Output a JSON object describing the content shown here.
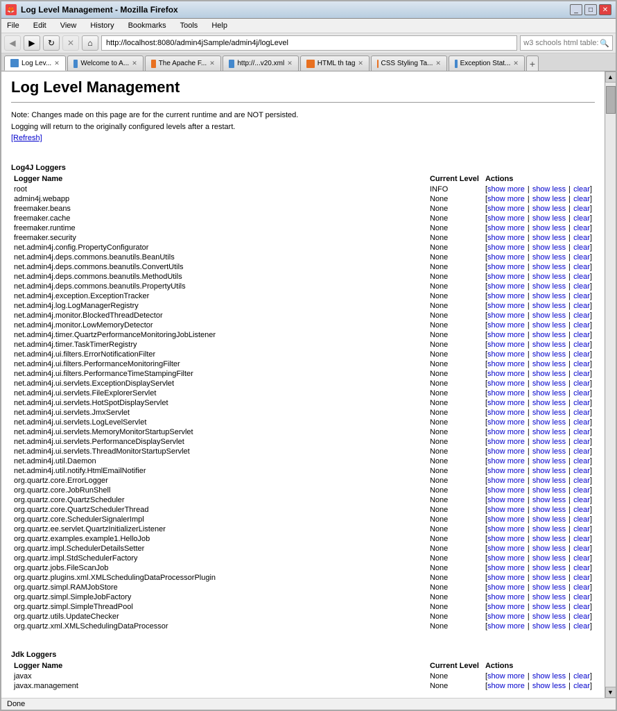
{
  "browser": {
    "title": "Log Level Management - Mozilla Firefox",
    "address": "http://localhost:8080/admin4jSample/admin4j/logLevel",
    "search_placeholder": "w3 schools html table:",
    "tabs": [
      {
        "label": "Log Lev...",
        "active": true,
        "icon": "blue"
      },
      {
        "label": "Welcome to A...",
        "active": false,
        "icon": "blue"
      },
      {
        "label": "The Apache F...",
        "active": false,
        "icon": "orange"
      },
      {
        "label": "http://...v20.xml",
        "active": false,
        "icon": "blue"
      },
      {
        "label": "HTML th tag",
        "active": false,
        "icon": "orange"
      },
      {
        "label": "CSS Styling Ta...",
        "active": false,
        "icon": "orange"
      },
      {
        "label": "Exception Stat...",
        "active": false,
        "icon": "blue"
      }
    ],
    "menus": [
      "File",
      "Edit",
      "View",
      "History",
      "Bookmarks",
      "Tools",
      "Help"
    ]
  },
  "page": {
    "title": "Log Level Management",
    "note_line1": "Note: Changes made on this page are for the current runtime and are NOT persisted.",
    "note_line2": "Logging will return to the originally configured levels after a restart.",
    "refresh_label": "[Refresh]",
    "log4j_section": "Log4J Loggers",
    "jdk_section": "Jdk Loggers",
    "col_logger": "Logger Name",
    "col_current": "Current Level",
    "col_actions": "Actions",
    "action_show_more": "show more",
    "action_show_less": "show less",
    "action_clear": "clear",
    "loggers": [
      {
        "name": "root",
        "level": "INFO"
      },
      {
        "name": "admin4j.webapp",
        "level": "None"
      },
      {
        "name": "freemaker.beans",
        "level": "None"
      },
      {
        "name": "freemaker.cache",
        "level": "None"
      },
      {
        "name": "freemaker.runtime",
        "level": "None"
      },
      {
        "name": "freemaker.security",
        "level": "None"
      },
      {
        "name": "net.admin4j.config.PropertyConfigurator",
        "level": "None"
      },
      {
        "name": "net.admin4j.deps.commons.beanutils.BeanUtils",
        "level": "None"
      },
      {
        "name": "net.admin4j.deps.commons.beanutils.ConvertUtils",
        "level": "None"
      },
      {
        "name": "net.admin4j.deps.commons.beanutils.MethodUtils",
        "level": "None"
      },
      {
        "name": "net.admin4j.deps.commons.beanutils.PropertyUtils",
        "level": "None"
      },
      {
        "name": "net.admin4j.exception.ExceptionTracker",
        "level": "None"
      },
      {
        "name": "net.admin4j.log.LogManagerRegistry",
        "level": "None"
      },
      {
        "name": "net.admin4j.monitor.BlockedThreadDetector",
        "level": "None"
      },
      {
        "name": "net.admin4j.monitor.LowMemoryDetector",
        "level": "None"
      },
      {
        "name": "net.admin4j.timer.QuartzPerformanceMonitoringJobListener",
        "level": "None"
      },
      {
        "name": "net.admin4j.timer.TaskTimerRegistry",
        "level": "None"
      },
      {
        "name": "net.admin4j.ui.filters.ErrorNotificationFilter",
        "level": "None"
      },
      {
        "name": "net.admin4j.ui.filters.PerformanceMonitoringFilter",
        "level": "None"
      },
      {
        "name": "net.admin4j.ui.filters.PerformanceTimeStampingFilter",
        "level": "None"
      },
      {
        "name": "net.admin4j.ui.servlets.ExceptionDisplayServlet",
        "level": "None"
      },
      {
        "name": "net.admin4j.ui.servlets.FileExplorerServlet",
        "level": "None"
      },
      {
        "name": "net.admin4j.ui.servlets.HotSpotDisplayServlet",
        "level": "None"
      },
      {
        "name": "net.admin4j.ui.servlets.JmxServlet",
        "level": "None"
      },
      {
        "name": "net.admin4j.ui.servlets.LogLevelServlet",
        "level": "None"
      },
      {
        "name": "net.admin4j.ui.servlets.MemoryMonitorStartupServlet",
        "level": "None"
      },
      {
        "name": "net.admin4j.ui.servlets.PerformanceDisplayServlet",
        "level": "None"
      },
      {
        "name": "net.admin4j.ui.servlets.ThreadMonitorStartupServlet",
        "level": "None"
      },
      {
        "name": "net.admin4j.util.Daemon",
        "level": "None"
      },
      {
        "name": "net.admin4j.util.notify.HtmlEmailNotifier",
        "level": "None"
      },
      {
        "name": "org.quartz.core.ErrorLogger",
        "level": "None"
      },
      {
        "name": "org.quartz.core.JobRunShell",
        "level": "None"
      },
      {
        "name": "org.quartz.core.QuartzScheduler",
        "level": "None"
      },
      {
        "name": "org.quartz.core.QuartzSchedulerThread",
        "level": "None"
      },
      {
        "name": "org.quartz.core.SchedulerSignalerImpl",
        "level": "None"
      },
      {
        "name": "org.quartz.ee.servlet.QuartzInitializerListener",
        "level": "None"
      },
      {
        "name": "org.quartz.examples.example1.HelloJob",
        "level": "None"
      },
      {
        "name": "org.quartz.impl.SchedulerDetailsSetter",
        "level": "None"
      },
      {
        "name": "org.quartz.impl.StdSchedulerFactory",
        "level": "None"
      },
      {
        "name": "org.quartz.jobs.FileScanJob",
        "level": "None"
      },
      {
        "name": "org.quartz.plugins.xml.XMLSchedulingDataProcessorPlugin",
        "level": "None"
      },
      {
        "name": "org.quartz.simpl.RAMJobStore",
        "level": "None"
      },
      {
        "name": "org.quartz.simpl.SimpleJobFactory",
        "level": "None"
      },
      {
        "name": "org.quartz.simpl.SimpleThreadPool",
        "level": "None"
      },
      {
        "name": "org.quartz.utils.UpdateChecker",
        "level": "None"
      },
      {
        "name": "org.quartz.xml.XMLSchedulingDataProcessor",
        "level": "None"
      }
    ],
    "jdk_loggers": [
      {
        "name": "javax",
        "level": "None"
      },
      {
        "name": "javax.management",
        "level": "None"
      }
    ]
  },
  "status": "Done"
}
